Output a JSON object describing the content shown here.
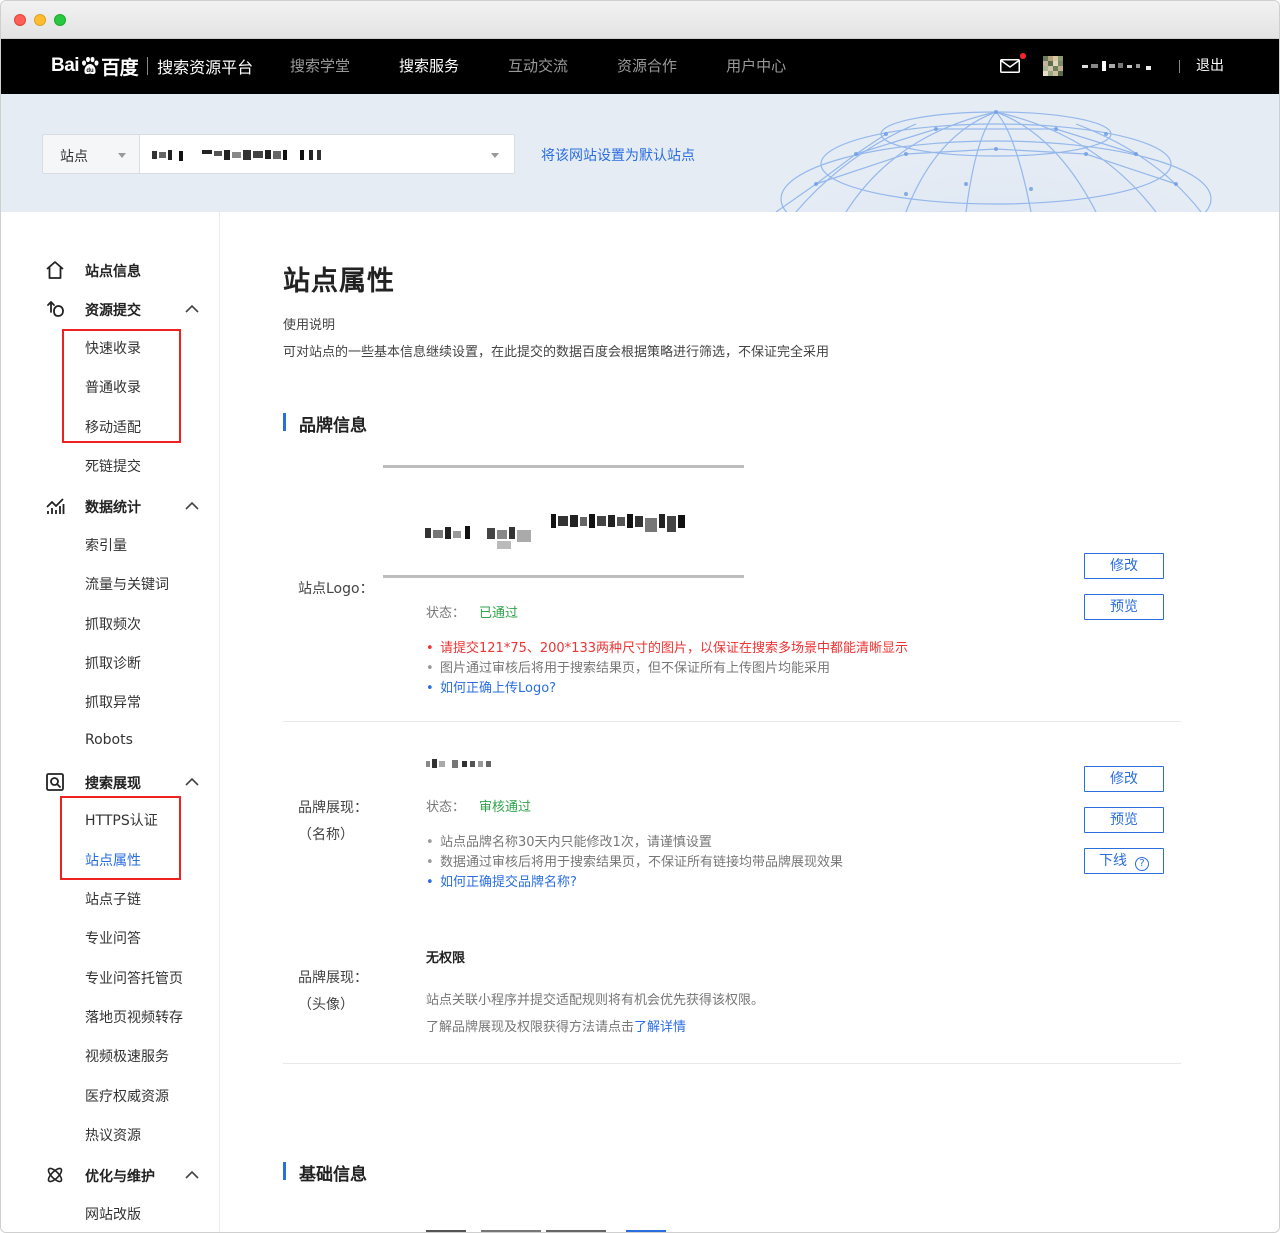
{
  "nav": {
    "logo_brand": "Bai",
    "logo_brand_tail": "百度",
    "logo_product": "搜索资源平台",
    "items": [
      "搜索学堂",
      "搜索服务",
      "互动交流",
      "资源合作",
      "用户中心"
    ],
    "active_index": 1,
    "logout": "退出",
    "mail_icon": "mail-icon"
  },
  "banner": {
    "site_select_label": "站点",
    "set_default_link": "将该网站设置为默认站点"
  },
  "sidebar": {
    "groups": [
      {
        "label": "站点信息",
        "icon": "home-icon"
      },
      {
        "label": "资源提交",
        "icon": "submit-icon",
        "items": [
          "快速收录",
          "普通收录",
          "移动适配",
          "死链提交"
        ]
      },
      {
        "label": "数据统计",
        "icon": "stats-icon",
        "items": [
          "索引量",
          "流量与关键词",
          "抓取频次",
          "抓取诊断",
          "抓取异常",
          "Robots"
        ]
      },
      {
        "label": "搜索展现",
        "icon": "search-display-icon",
        "items": [
          "HTTPS认证",
          "站点属性",
          "站点子链",
          "专业问答",
          "专业问答托管页",
          "落地页视频转存",
          "视频极速服务",
          "医疗权威资源",
          "热议资源"
        ]
      },
      {
        "label": "优化与维护",
        "icon": "optimize-icon",
        "items": [
          "网站改版"
        ]
      }
    ],
    "active_item": "站点属性"
  },
  "main": {
    "page_title": "站点属性",
    "usage_title": "使用说明",
    "usage_desc": "可对站点的一些基本信息继续设置，在此提交的数据百度会根据策略进行筛选，不保证完全采用",
    "brand_section": "品牌信息",
    "logo": {
      "label": "站点Logo：",
      "status_label": "状态：",
      "status_value": "已通过",
      "bullets": [
        "请提交121*75、200*133两种尺寸的图片，以保证在搜索多场景中都能清晰显示",
        "图片通过审核后将用于搜索结果页，但不保证所有上传图片均能采用",
        "如何正确上传Logo?"
      ],
      "btn_edit": "修改",
      "btn_preview": "预览"
    },
    "brand_name": {
      "label_line1": "品牌展现：",
      "label_line2": "（名称）",
      "status_label": "状态：",
      "status_value": "审核通过",
      "bullets": [
        "站点品牌名称30天内只能修改1次，请谨慎设置",
        "数据通过审核后将用于搜索结果页，不保证所有链接均带品牌展现效果",
        "如何正确提交品牌名称?"
      ],
      "btn_edit": "修改",
      "btn_preview": "预览",
      "btn_offline": "下线",
      "help_glyph": "?"
    },
    "brand_avatar": {
      "label_line1": "品牌展现：",
      "label_line2": "（头像）",
      "no_permission": "无权限",
      "desc1": "站点关联小程序并提交适配规则将有机会优先获得该权限。",
      "desc2_prefix": "了解品牌展现及权限获得方法请点击",
      "desc2_link": "了解详情"
    },
    "basic_section": "基础信息"
  },
  "colors": {
    "accent": "#2a6ee0",
    "success": "#2fa34a",
    "warning": "#e33333",
    "highlight_box": "#e22222",
    "topnav_bg": "#000000",
    "banner_bg": "#e6ecf4"
  }
}
